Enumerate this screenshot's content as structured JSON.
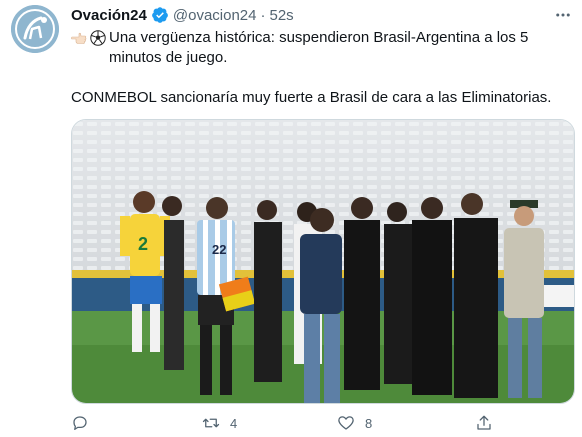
{
  "tweet": {
    "display_name": "Ovación24",
    "handle": "@ovacion24",
    "separator": "·",
    "time": "52s",
    "text_line1": "Una vergüenza histórica: suspendieron Brasil-Argentina a los 5 minutos de juego.",
    "text_line2": "CONMEBOL sancionaría muy fuerte a Brasil de cara a las Eliminatorias.",
    "emojis": [
      "point-left-icon",
      "soccer-ball-icon"
    ],
    "media": {
      "jersey_numbers": [
        "2",
        "22"
      ]
    },
    "actions": {
      "reply_count": "",
      "retweet_count": "4",
      "like_count": "8"
    }
  },
  "colors": {
    "text": "#0f1419",
    "secondary": "#536471",
    "verified": "#1d9bf0",
    "avatar_bg": "#8fb6cf"
  }
}
